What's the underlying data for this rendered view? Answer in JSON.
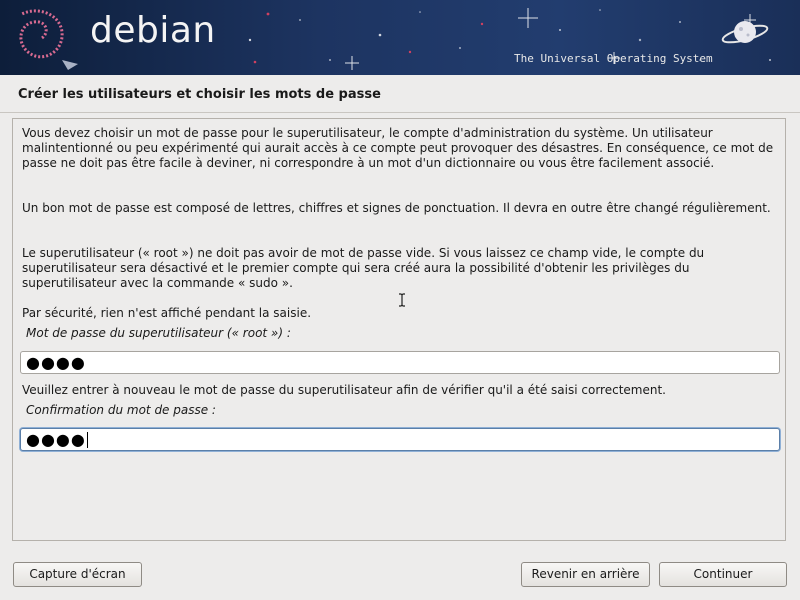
{
  "banner": {
    "brand": "debian",
    "tagline": "The Universal Operating System"
  },
  "page_title": "Créer les utilisateurs et choisir les mots de passe",
  "content": {
    "paragraphs": [
      "Vous devez choisir un mot de passe pour le superutilisateur, le compte d'administration du système. Un utilisateur malintentionné ou peu expérimenté qui aurait accès à ce compte peut provoquer des désastres. En conséquence, ce mot de passe ne doit pas être facile à deviner, ni correspondre à un mot d'un dictionnaire ou vous être facilement associé.",
      "Un bon mot de passe est composé de lettres, chiffres et signes de ponctuation. Il devra en outre être changé régulièrement.",
      "Le superutilisateur (« root ») ne doit pas avoir de mot de passe vide. Si vous laissez ce champ vide, le compte du superutilisateur sera désactivé et le premier compte qui sera créé aura la possibilité d'obtenir les privilèges du superutilisateur avec la commande « sudo ».",
      "Par sécurité, rien n'est affiché pendant la saisie."
    ],
    "root_password_label": "Mot de passe du superutilisateur (« root ») :",
    "root_password_value": "●●●●",
    "confirm_instruction": "Veuillez entrer à nouveau le mot de passe du superutilisateur afin de vérifier qu'il a été saisi correctement.",
    "confirm_label": "Confirmation du mot de passe :",
    "confirm_value": "●●●●"
  },
  "buttons": {
    "screenshot": "Capture d'écran",
    "back": "Revenir en arrière",
    "continue": "Continuer"
  },
  "colors": {
    "banner_bg": "#1d3461",
    "page_bg": "#edeceb",
    "focus_ring": "#8fb0d6"
  }
}
